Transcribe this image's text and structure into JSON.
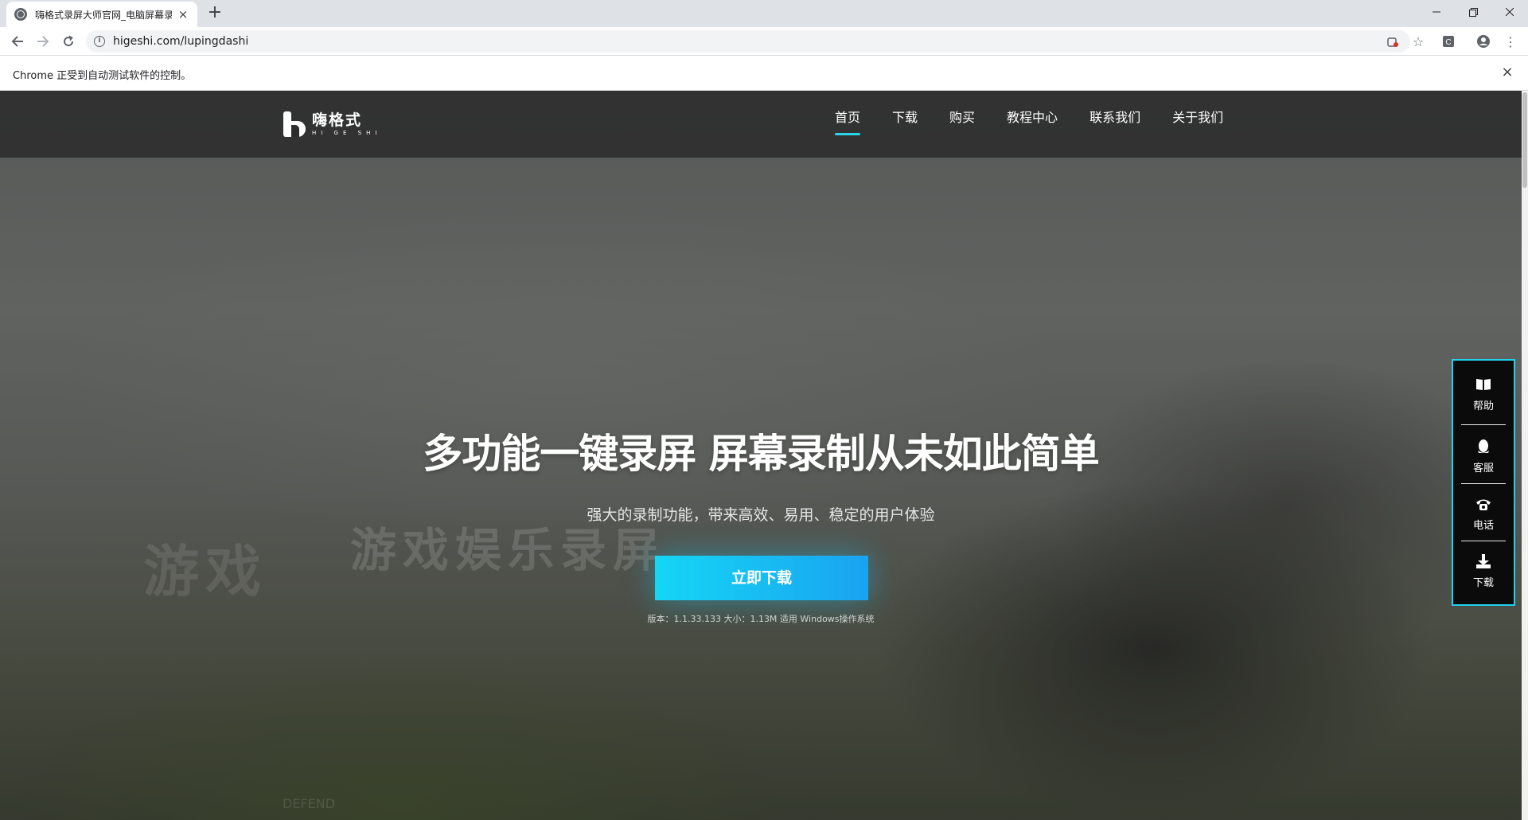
{
  "browser": {
    "tab_title": "嗨格式录屏大师官网_电脑屏幕录",
    "url": "higeshi.com/lupingdashi",
    "infobar_text": "Chrome 正受到自动测试软件的控制。"
  },
  "site": {
    "logo_cn": "嗨格式",
    "logo_en": "HI GE SHI",
    "nav": [
      {
        "label": "首页"
      },
      {
        "label": "下载"
      },
      {
        "label": "购买"
      },
      {
        "label": "教程中心"
      },
      {
        "label": "联系我们"
      },
      {
        "label": "关于我们"
      }
    ],
    "active_nav": "首页"
  },
  "hero": {
    "title": "多功能一键录屏 屏幕录制从未如此简单",
    "subtitle": "强大的录制功能，带来高效、易用、稳定的用户体验",
    "cta_label": "立即下载",
    "version_info": "版本：1.1.33.133 大小：1.13M 适用 Windows操作系统",
    "background_text_1": "游戏",
    "background_text_2": "游戏娱乐录屏",
    "background_text_3": "DEFEND"
  },
  "float_panel": {
    "items": [
      {
        "label": "帮助",
        "icon": "book-icon"
      },
      {
        "label": "客服",
        "icon": "qq-icon"
      },
      {
        "label": "电话",
        "icon": "phone-icon"
      },
      {
        "label": "下载",
        "icon": "download-icon"
      }
    ]
  },
  "colors": {
    "accent": "#1fd1ee",
    "cta_start": "#15d6f5",
    "cta_end": "#1aa3f0",
    "header_bg": "#2d2d2d"
  }
}
